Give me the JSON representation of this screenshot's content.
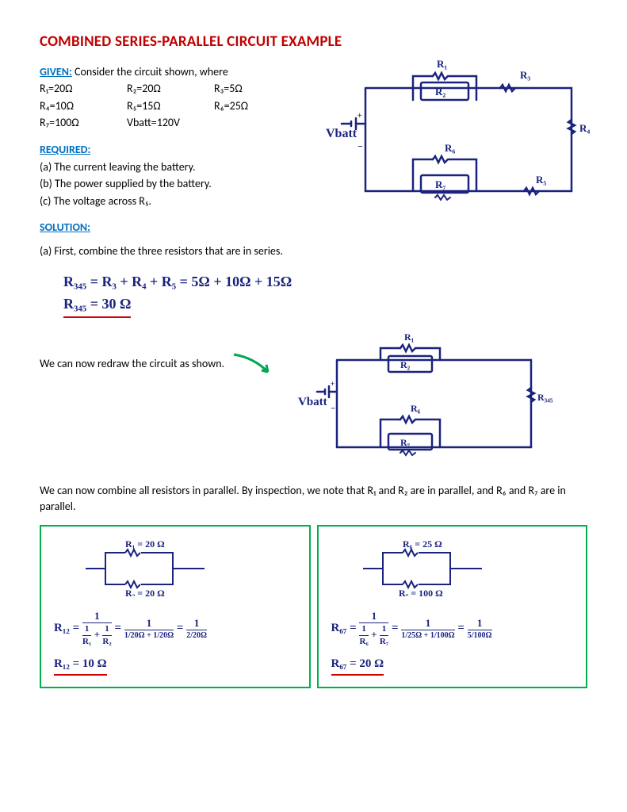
{
  "title": "COMBINED SERIES-PARALLEL CIRCUIT EXAMPLE",
  "given_label": "GIVEN:",
  "given_intro": " Consider the circuit shown, where",
  "R1": "R₁=20Ω",
  "R2": "R₂=20Ω",
  "R3": "R₃=5Ω",
  "R4": "R₄=10Ω",
  "R5": "R₅=15Ω",
  "R6": "R₆=25Ω",
  "R7": "R₇=100Ω",
  "Vbatt": "Vbatt=120V",
  "required_label": "REQUIRED:",
  "req_a": "(a) The current leaving the battery.",
  "req_b": "(b) The power supplied by the battery.",
  "req_c": "(c) The voltage across R₅.",
  "solution_label": "SOLUTION:",
  "sol_a_intro": "(a) First, combine the three resistors that are in series.",
  "hw_line1": "R₃₄₅  =  R₃ + R₄ + R₅  =  5Ω + 10Ω + 15Ω",
  "hw_line2": "R₃₄₅ =  30 Ω",
  "redraw_text": "We can now redraw the circuit as shown.",
  "parallel_intro": "We can now combine all resistors in parallel. By inspection, we note that R₁ and R₂ are in parallel, and R₆ and R₇ are in parallel.",
  "box1": {
    "r1": "R₁ = 20 Ω",
    "r2": "R₂ = 20 Ω",
    "eq_lhs": "R₁₂  =",
    "num1": "1",
    "den1a": "1",
    "den1aR": "R₁",
    "den1b": "1",
    "den1bR": "R₂",
    "mid_num": "1",
    "mid_den": "1/20Ω + 1/20Ω",
    "rhs_num": "1",
    "rhs_den": "2/20Ω",
    "result": "R₁₂ =  10 Ω"
  },
  "box2": {
    "r6": "R₆ = 25 Ω",
    "r7": "R₇ = 100 Ω",
    "eq_lhs": "R₆₇ =",
    "num1": "1",
    "den1a": "1",
    "den1aR": "R₆",
    "den1b": "1",
    "den1bR": "R₇",
    "mid_num": "1",
    "mid_den": "1/25Ω + 1/100Ω",
    "rhs_num": "1",
    "rhs_den": "5/100Ω",
    "result": "R₆₇ = 20 Ω"
  },
  "circ1": {
    "R1": "R₁",
    "R2": "R₂",
    "R3": "R₃",
    "R4": "R₄",
    "R5": "R₅",
    "R6": "R₆",
    "R7": "R₇",
    "V": "Vbatt"
  },
  "circ2": {
    "R1": "R₁",
    "R2": "R₂",
    "R345": "R₃₄₅",
    "R6": "R₆",
    "R7": "R₇",
    "V": "Vbatt"
  }
}
